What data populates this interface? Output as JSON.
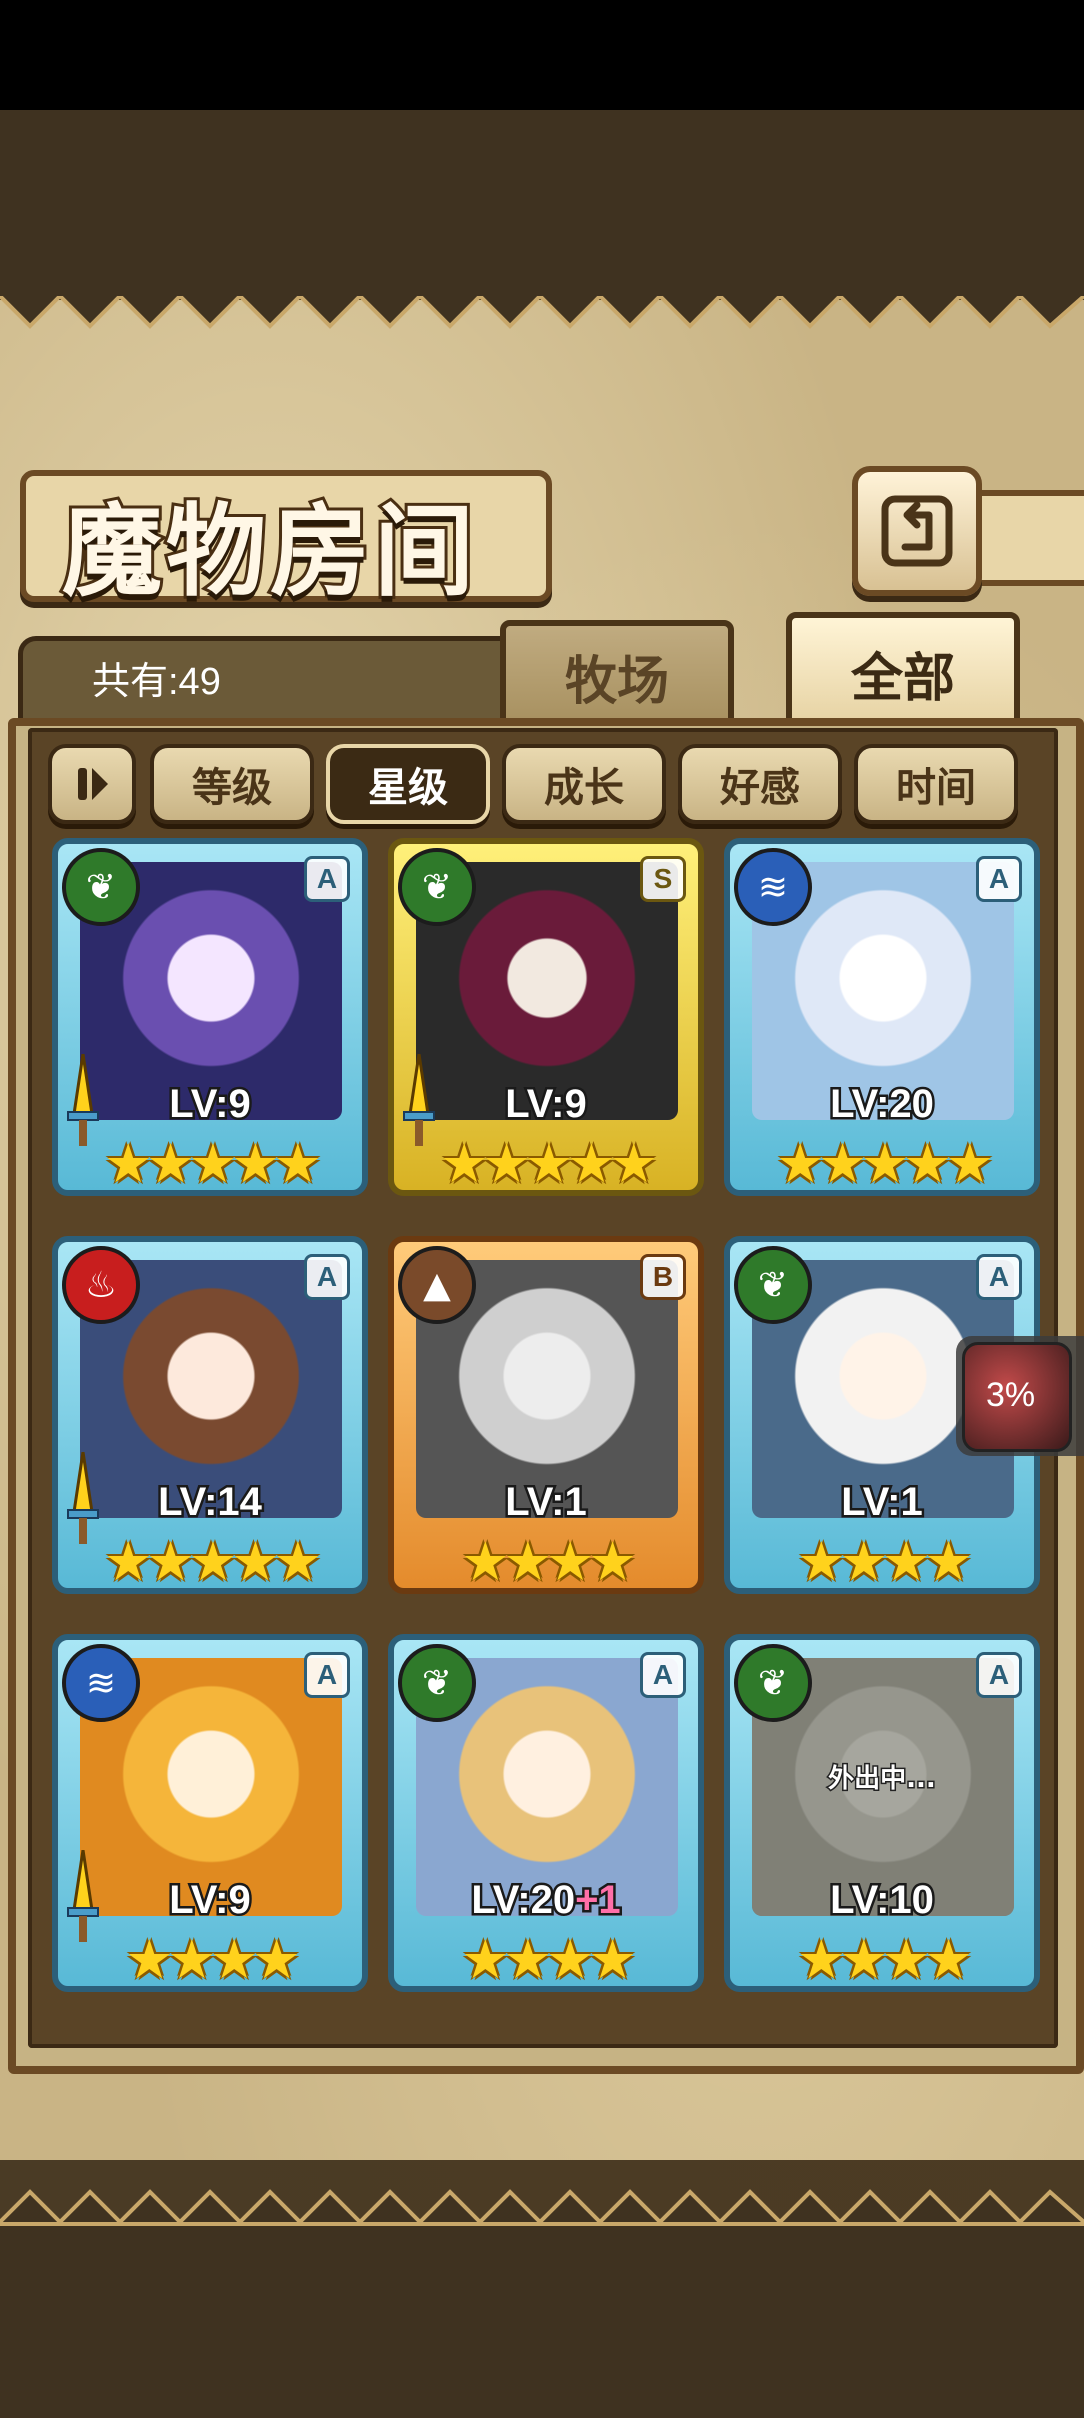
{
  "title": "魔物房间",
  "count_label": "共有:49",
  "tabs": {
    "farm": "牧场",
    "all": "全部"
  },
  "filters": {
    "sort_icon": "pause-icon",
    "level": "等级",
    "star": "星级",
    "growth": "成长",
    "affection": "好感",
    "time": "时间"
  },
  "float_percent": "3%",
  "cards": [
    {
      "rank": "A",
      "element": "leaf",
      "level": "LV:9",
      "plus": "",
      "stars": "★★★★★",
      "frame": "blue",
      "has_sword": true
    },
    {
      "rank": "S",
      "element": "leaf",
      "level": "LV:9",
      "plus": "",
      "stars": "★★★★★",
      "frame": "gold",
      "has_sword": true
    },
    {
      "rank": "A",
      "element": "water",
      "level": "LV:20",
      "plus": "",
      "stars": "★★★★★",
      "frame": "blue",
      "has_sword": false
    },
    {
      "rank": "A",
      "element": "fire",
      "level": "LV:14",
      "plus": "",
      "stars": "★★★★★",
      "frame": "blue",
      "has_sword": true
    },
    {
      "rank": "B",
      "element": "earth",
      "level": "LV:1",
      "plus": "",
      "stars": "★★★★",
      "frame": "orange",
      "has_sword": false
    },
    {
      "rank": "A",
      "element": "leaf",
      "level": "LV:1",
      "plus": "",
      "stars": "★★★★",
      "frame": "blue",
      "has_sword": false
    },
    {
      "rank": "A",
      "element": "water",
      "level": "LV:9",
      "plus": "",
      "stars": "★★★★",
      "frame": "blue",
      "has_sword": true
    },
    {
      "rank": "A",
      "element": "leaf",
      "level": "LV:20",
      "plus": "+1",
      "stars": "★★★★",
      "frame": "blue",
      "has_sword": false
    },
    {
      "rank": "A",
      "element": "leaf",
      "level": "LV:10",
      "plus": "",
      "stars": "★★★★",
      "frame": "blue",
      "has_sword": false,
      "status": "外出中..."
    }
  ],
  "colors": {
    "parchment": "#c9b485",
    "frame_brown": "#6b4a24",
    "card_blue": "#58b9d6",
    "card_gold": "#d8b224",
    "card_orange": "#e48b2c",
    "star": "#ffd21c"
  }
}
